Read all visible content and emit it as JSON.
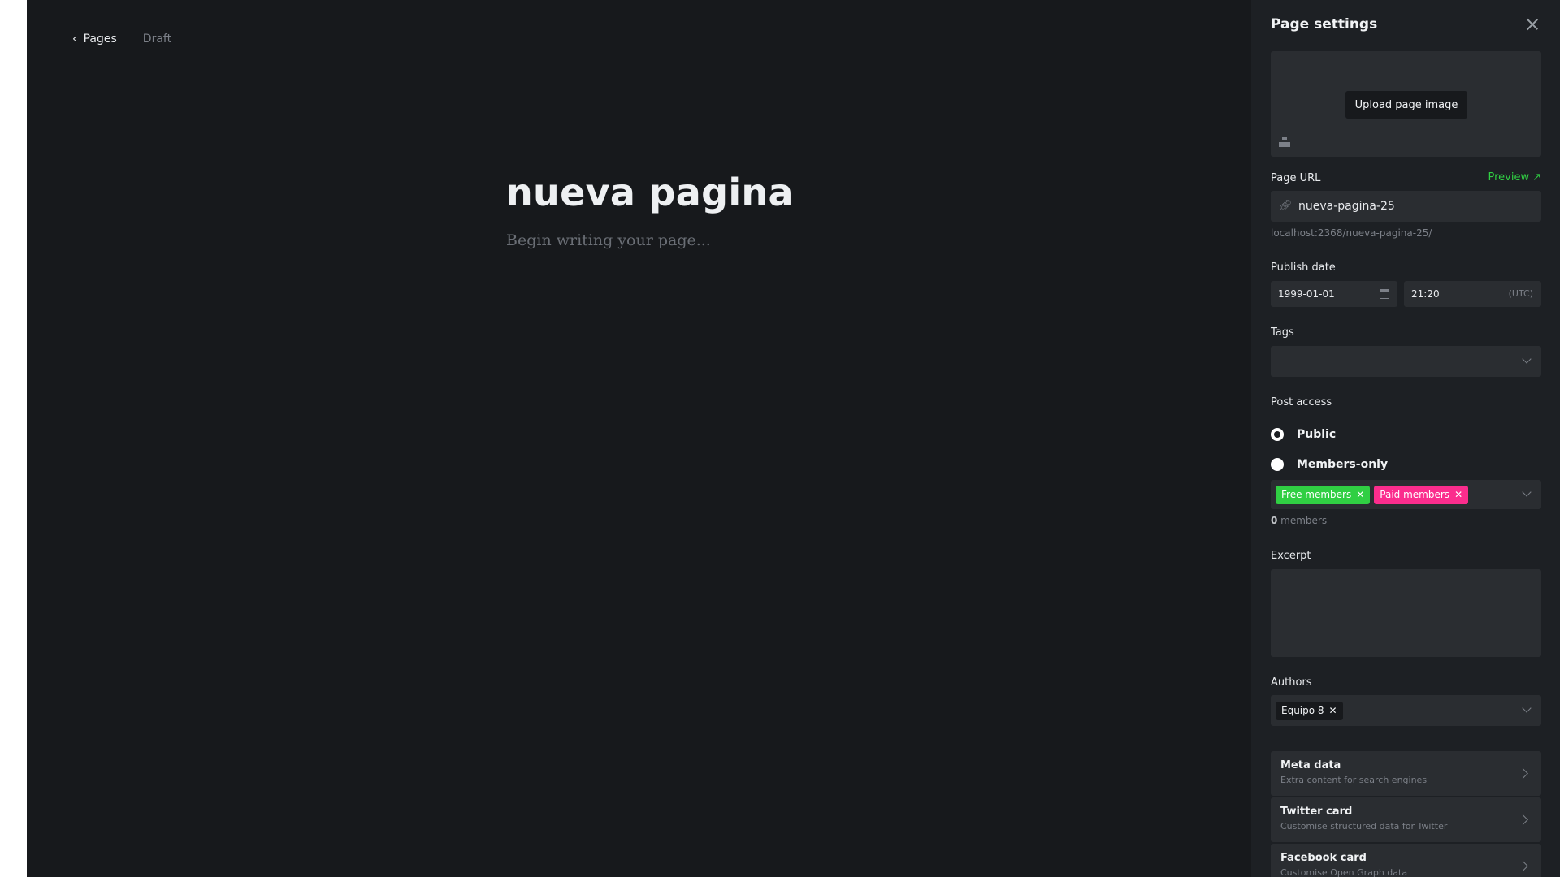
{
  "editor": {
    "back_label": "Pages",
    "status": "Draft",
    "title": "nueva pagina",
    "body_placeholder": "Begin writing your page..."
  },
  "settings": {
    "title": "Page settings",
    "upload_label": "Upload page image",
    "page_url_label": "Page URL",
    "preview_label": "Preview",
    "slug": "nueva-pagina-25",
    "url_hint": "localhost:2368/nueva-pagina-25/",
    "publish_date_label": "Publish date",
    "date": "1999-01-01",
    "time": "21:20",
    "timezone": "(UTC)",
    "tags_label": "Tags",
    "post_access_label": "Post access",
    "access_options": [
      {
        "label": "Public",
        "selected": true
      },
      {
        "label": "Members-only",
        "selected": false
      }
    ],
    "member_tiers": [
      {
        "label": "Free members",
        "color": "#30cf43"
      },
      {
        "label": "Paid members",
        "color": "#fb2d8d"
      }
    ],
    "members_count": "0",
    "members_suffix": " members",
    "excerpt_label": "Excerpt",
    "excerpt_value": "",
    "authors_label": "Authors",
    "authors": [
      "Equipo 8"
    ],
    "cards": [
      {
        "title": "Meta data",
        "subtitle": "Extra content for search engines"
      },
      {
        "title": "Twitter card",
        "subtitle": "Customise structured data for Twitter"
      },
      {
        "title": "Facebook card",
        "subtitle": "Customise Open Graph data"
      }
    ]
  },
  "colors": {
    "accent_green": "#30cf43",
    "accent_pink": "#fb2d8d",
    "editor_bg": "#17191c",
    "panel_bg": "#1d2024"
  }
}
